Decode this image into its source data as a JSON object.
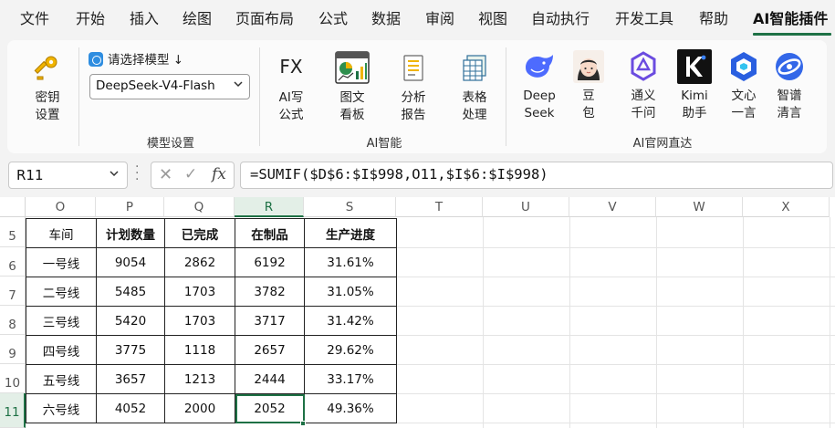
{
  "menu": {
    "items": [
      "文件",
      "开始",
      "插入",
      "绘图",
      "页面布局",
      "公式",
      "数据",
      "审阅",
      "视图",
      "自动执行",
      "开发工具",
      "帮助",
      "AI智能插件"
    ],
    "active": "AI智能插件"
  },
  "ribbon": {
    "key_button": "密钥\n设置",
    "model_prompt": "请选择模型",
    "model_arrow": "↓",
    "model_selected": "DeepSeek-V4-Flash",
    "group_model_label": "模型设置",
    "ai_buttons": [
      {
        "icon": "FX",
        "label": "AI写\n公式"
      },
      {
        "icon": "chart-board-icon",
        "label": "图文\n看板"
      },
      {
        "icon": "report-icon",
        "label": "分析\n报告"
      },
      {
        "icon": "table-icon",
        "label": "表格\n处理"
      }
    ],
    "group_ai_label": "AI智能",
    "site_buttons": [
      {
        "icon": "deepseek-icon",
        "label": "Deep\nSeek",
        "color": "#4d6bfe"
      },
      {
        "icon": "doubao-icon",
        "label": "豆\n包",
        "color": "#f2c9b8"
      },
      {
        "icon": "tongyi-icon",
        "label": "通义\n千问",
        "color": "#6b4ce0"
      },
      {
        "icon": "kimi-icon",
        "label": "Kimi\n助手",
        "color": "#111111"
      },
      {
        "icon": "wenxin-icon",
        "label": "文心\n一言",
        "color": "#2a5fe0"
      },
      {
        "icon": "zhipu-icon",
        "label": "智谱\n清言",
        "color": "#3367e8"
      }
    ],
    "group_site_label": "AI官网直达"
  },
  "formula_bar": {
    "name_box": "R11",
    "formula": "=SUMIF($D$6:$I$998,O11,$I$6:$I$998)"
  },
  "grid": {
    "columns": [
      "O",
      "P",
      "Q",
      "R",
      "S",
      "T",
      "U",
      "V",
      "W",
      "X"
    ],
    "rows": [
      "5",
      "6",
      "7",
      "8",
      "9",
      "10",
      "11"
    ],
    "selected_column": "R",
    "selected_row": "11"
  },
  "table": {
    "headers": [
      "车间",
      "计划数量",
      "已完成",
      "在制品",
      "生产进度"
    ],
    "rows": [
      [
        "一号线",
        "9054",
        "2862",
        "6192",
        "31.61%"
      ],
      [
        "二号线",
        "5485",
        "1703",
        "3782",
        "31.05%"
      ],
      [
        "三号线",
        "5420",
        "1703",
        "3717",
        "31.42%"
      ],
      [
        "四号线",
        "3775",
        "1118",
        "2657",
        "29.62%"
      ],
      [
        "五号线",
        "3657",
        "1213",
        "2444",
        "33.17%"
      ],
      [
        "六号线",
        "4052",
        "2000",
        "2052",
        "49.36%"
      ]
    ]
  },
  "colors": {
    "accent": "#1e7145",
    "ribbon_bg": "#f3f3f3"
  }
}
